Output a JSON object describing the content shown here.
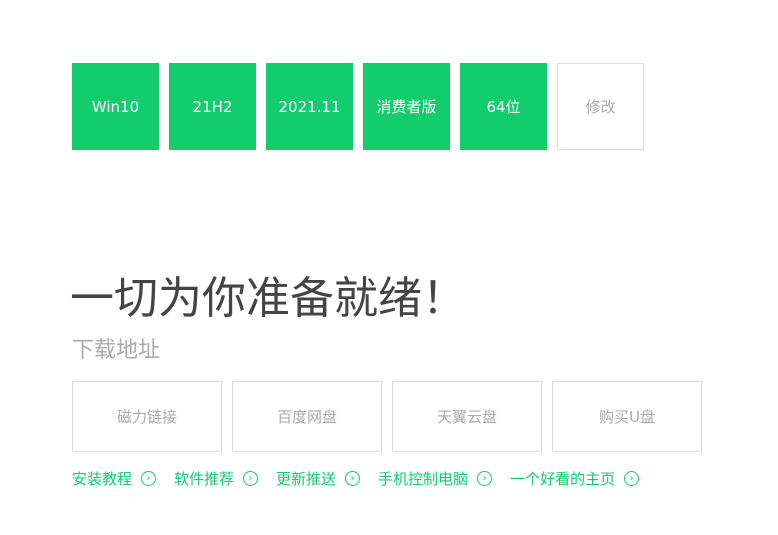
{
  "options": [
    "Win10",
    "21H2",
    "2021.11",
    "消费者版",
    "64位"
  ],
  "edit_label": "修改",
  "heading": "一切为你准备就绪！",
  "subtitle": "下载地址",
  "downloads": [
    "磁力链接",
    "百度网盘",
    "天翼云盘",
    "购买U盘"
  ],
  "links": [
    "安装教程",
    "软件推荐",
    "更新推送",
    "手机控制电脑",
    "一个好看的主页"
  ],
  "colors": {
    "accent": "#13cc6e",
    "border": "#dddddd",
    "muted": "#aaaaaa"
  }
}
